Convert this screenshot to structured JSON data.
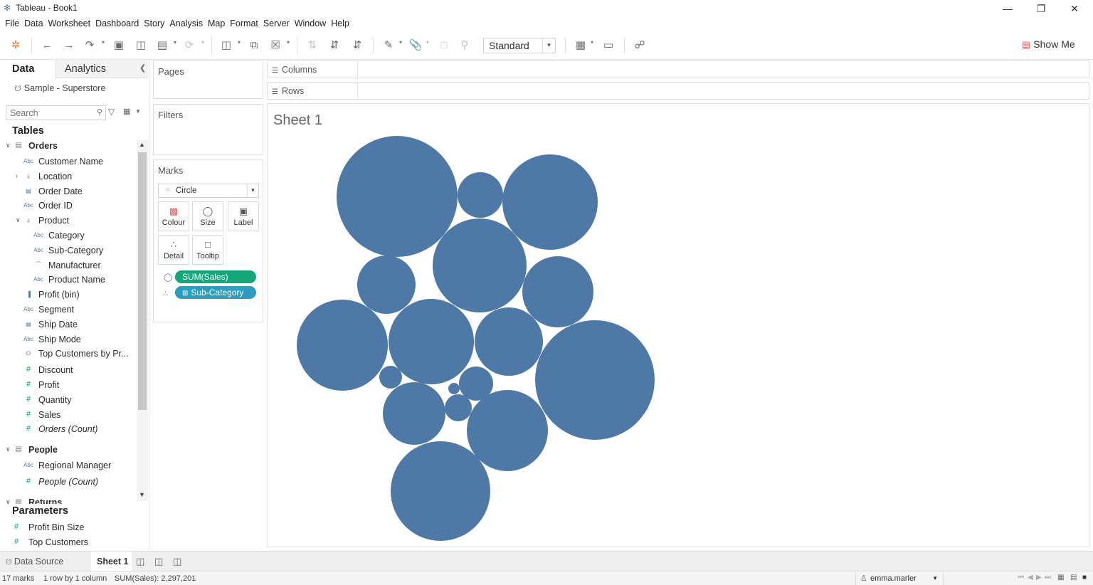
{
  "window": {
    "title": "Tableau - Book1",
    "controls": [
      "minimize-icon",
      "restore-icon",
      "close-icon"
    ]
  },
  "menu": [
    "File",
    "Data",
    "Worksheet",
    "Dashboard",
    "Story",
    "Analysis",
    "Map",
    "Format",
    "Server",
    "Window",
    "Help"
  ],
  "toolbar": {
    "fit_value": "Standard",
    "show_me_label": "Show Me"
  },
  "data_pane": {
    "tab_data": "Data",
    "tab_analytics": "Analytics",
    "datasource": "Sample - Superstore",
    "search_placeholder": "Search",
    "tables_heading": "Tables",
    "fields": [
      {
        "label": "Orders",
        "kind": "table",
        "expand": "open"
      },
      {
        "label": "Customer Name",
        "kind": "abc"
      },
      {
        "label": "Location",
        "kind": "hier",
        "expand": "closed"
      },
      {
        "label": "Order Date",
        "kind": "date"
      },
      {
        "label": "Order ID",
        "kind": "abc"
      },
      {
        "label": "Product",
        "kind": "hier",
        "expand": "open"
      },
      {
        "label": "Category",
        "kind": "abc",
        "indent": 1
      },
      {
        "label": "Sub-Category",
        "kind": "abc",
        "indent": 1
      },
      {
        "label": "Manufacturer",
        "kind": "link",
        "indent": 1
      },
      {
        "label": "Product Name",
        "kind": "abc",
        "indent": 1
      },
      {
        "label": "Profit (bin)",
        "kind": "bin"
      },
      {
        "label": "Segment",
        "kind": "abc"
      },
      {
        "label": "Ship Date",
        "kind": "date"
      },
      {
        "label": "Ship Mode",
        "kind": "abc"
      },
      {
        "label": "Top Customers by Pr...",
        "kind": "set"
      },
      {
        "label": "Discount",
        "kind": "num"
      },
      {
        "label": "Profit",
        "kind": "num"
      },
      {
        "label": "Quantity",
        "kind": "num"
      },
      {
        "label": "Sales",
        "kind": "num"
      },
      {
        "label": "Orders (Count)",
        "kind": "num",
        "italic": true
      },
      {
        "label": "People",
        "kind": "table",
        "expand": "open"
      },
      {
        "label": "Regional Manager",
        "kind": "abc"
      },
      {
        "label": "People (Count)",
        "kind": "num",
        "italic": true
      },
      {
        "label": "Returns",
        "kind": "table",
        "expand": "open"
      }
    ],
    "parameters_heading": "Parameters",
    "parameters": [
      "Profit Bin Size",
      "Top Customers"
    ]
  },
  "cards": {
    "pages": "Pages",
    "filters": "Filters",
    "marks": "Marks",
    "mark_type": "Circle",
    "mark_buttons": [
      {
        "label": "Colour",
        "icon": "colour-icon"
      },
      {
        "label": "Size",
        "icon": "size-icon"
      },
      {
        "label": "Label",
        "icon": "label-icon"
      },
      {
        "label": "Detail",
        "icon": "detail-icon"
      },
      {
        "label": "Tooltip",
        "icon": "tooltip-icon"
      }
    ],
    "pills": [
      {
        "label": "SUM(Sales)",
        "color": "#14a679",
        "icon": "size-icon"
      },
      {
        "label": "Sub-Category",
        "color": "#2e9dbd",
        "icon": "detail-icon"
      }
    ]
  },
  "shelves": {
    "columns": "Columns",
    "rows": "Rows"
  },
  "sheet": {
    "title": "Sheet 1",
    "bubble_color": "#4e79a7",
    "bubble_count": 17
  },
  "tabs": {
    "data_source": "Data Source",
    "active_sheet": "Sheet 1"
  },
  "status": {
    "marks": "17 marks",
    "dims": "1 row by 1 column",
    "sum": "SUM(Sales): 2,297,201",
    "user": "emma.marler"
  }
}
